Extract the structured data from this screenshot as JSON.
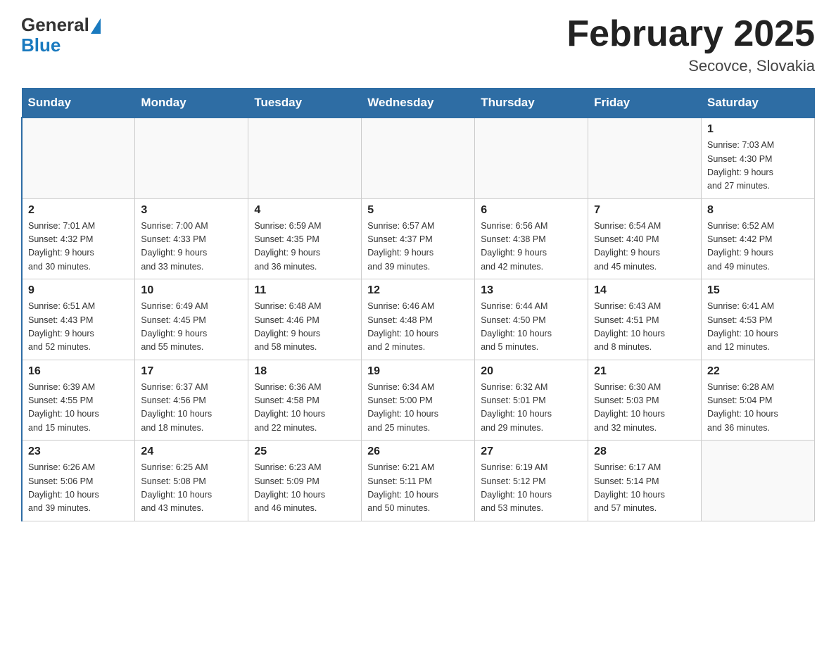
{
  "header": {
    "logo_general": "General",
    "logo_blue": "Blue",
    "month_title": "February 2025",
    "location": "Secovce, Slovakia"
  },
  "weekdays": [
    "Sunday",
    "Monday",
    "Tuesday",
    "Wednesday",
    "Thursday",
    "Friday",
    "Saturday"
  ],
  "weeks": [
    [
      {
        "num": "",
        "info": ""
      },
      {
        "num": "",
        "info": ""
      },
      {
        "num": "",
        "info": ""
      },
      {
        "num": "",
        "info": ""
      },
      {
        "num": "",
        "info": ""
      },
      {
        "num": "",
        "info": ""
      },
      {
        "num": "1",
        "info": "Sunrise: 7:03 AM\nSunset: 4:30 PM\nDaylight: 9 hours\nand 27 minutes."
      }
    ],
    [
      {
        "num": "2",
        "info": "Sunrise: 7:01 AM\nSunset: 4:32 PM\nDaylight: 9 hours\nand 30 minutes."
      },
      {
        "num": "3",
        "info": "Sunrise: 7:00 AM\nSunset: 4:33 PM\nDaylight: 9 hours\nand 33 minutes."
      },
      {
        "num": "4",
        "info": "Sunrise: 6:59 AM\nSunset: 4:35 PM\nDaylight: 9 hours\nand 36 minutes."
      },
      {
        "num": "5",
        "info": "Sunrise: 6:57 AM\nSunset: 4:37 PM\nDaylight: 9 hours\nand 39 minutes."
      },
      {
        "num": "6",
        "info": "Sunrise: 6:56 AM\nSunset: 4:38 PM\nDaylight: 9 hours\nand 42 minutes."
      },
      {
        "num": "7",
        "info": "Sunrise: 6:54 AM\nSunset: 4:40 PM\nDaylight: 9 hours\nand 45 minutes."
      },
      {
        "num": "8",
        "info": "Sunrise: 6:52 AM\nSunset: 4:42 PM\nDaylight: 9 hours\nand 49 minutes."
      }
    ],
    [
      {
        "num": "9",
        "info": "Sunrise: 6:51 AM\nSunset: 4:43 PM\nDaylight: 9 hours\nand 52 minutes."
      },
      {
        "num": "10",
        "info": "Sunrise: 6:49 AM\nSunset: 4:45 PM\nDaylight: 9 hours\nand 55 minutes."
      },
      {
        "num": "11",
        "info": "Sunrise: 6:48 AM\nSunset: 4:46 PM\nDaylight: 9 hours\nand 58 minutes."
      },
      {
        "num": "12",
        "info": "Sunrise: 6:46 AM\nSunset: 4:48 PM\nDaylight: 10 hours\nand 2 minutes."
      },
      {
        "num": "13",
        "info": "Sunrise: 6:44 AM\nSunset: 4:50 PM\nDaylight: 10 hours\nand 5 minutes."
      },
      {
        "num": "14",
        "info": "Sunrise: 6:43 AM\nSunset: 4:51 PM\nDaylight: 10 hours\nand 8 minutes."
      },
      {
        "num": "15",
        "info": "Sunrise: 6:41 AM\nSunset: 4:53 PM\nDaylight: 10 hours\nand 12 minutes."
      }
    ],
    [
      {
        "num": "16",
        "info": "Sunrise: 6:39 AM\nSunset: 4:55 PM\nDaylight: 10 hours\nand 15 minutes."
      },
      {
        "num": "17",
        "info": "Sunrise: 6:37 AM\nSunset: 4:56 PM\nDaylight: 10 hours\nand 18 minutes."
      },
      {
        "num": "18",
        "info": "Sunrise: 6:36 AM\nSunset: 4:58 PM\nDaylight: 10 hours\nand 22 minutes."
      },
      {
        "num": "19",
        "info": "Sunrise: 6:34 AM\nSunset: 5:00 PM\nDaylight: 10 hours\nand 25 minutes."
      },
      {
        "num": "20",
        "info": "Sunrise: 6:32 AM\nSunset: 5:01 PM\nDaylight: 10 hours\nand 29 minutes."
      },
      {
        "num": "21",
        "info": "Sunrise: 6:30 AM\nSunset: 5:03 PM\nDaylight: 10 hours\nand 32 minutes."
      },
      {
        "num": "22",
        "info": "Sunrise: 6:28 AM\nSunset: 5:04 PM\nDaylight: 10 hours\nand 36 minutes."
      }
    ],
    [
      {
        "num": "23",
        "info": "Sunrise: 6:26 AM\nSunset: 5:06 PM\nDaylight: 10 hours\nand 39 minutes."
      },
      {
        "num": "24",
        "info": "Sunrise: 6:25 AM\nSunset: 5:08 PM\nDaylight: 10 hours\nand 43 minutes."
      },
      {
        "num": "25",
        "info": "Sunrise: 6:23 AM\nSunset: 5:09 PM\nDaylight: 10 hours\nand 46 minutes."
      },
      {
        "num": "26",
        "info": "Sunrise: 6:21 AM\nSunset: 5:11 PM\nDaylight: 10 hours\nand 50 minutes."
      },
      {
        "num": "27",
        "info": "Sunrise: 6:19 AM\nSunset: 5:12 PM\nDaylight: 10 hours\nand 53 minutes."
      },
      {
        "num": "28",
        "info": "Sunrise: 6:17 AM\nSunset: 5:14 PM\nDaylight: 10 hours\nand 57 minutes."
      },
      {
        "num": "",
        "info": ""
      }
    ]
  ]
}
